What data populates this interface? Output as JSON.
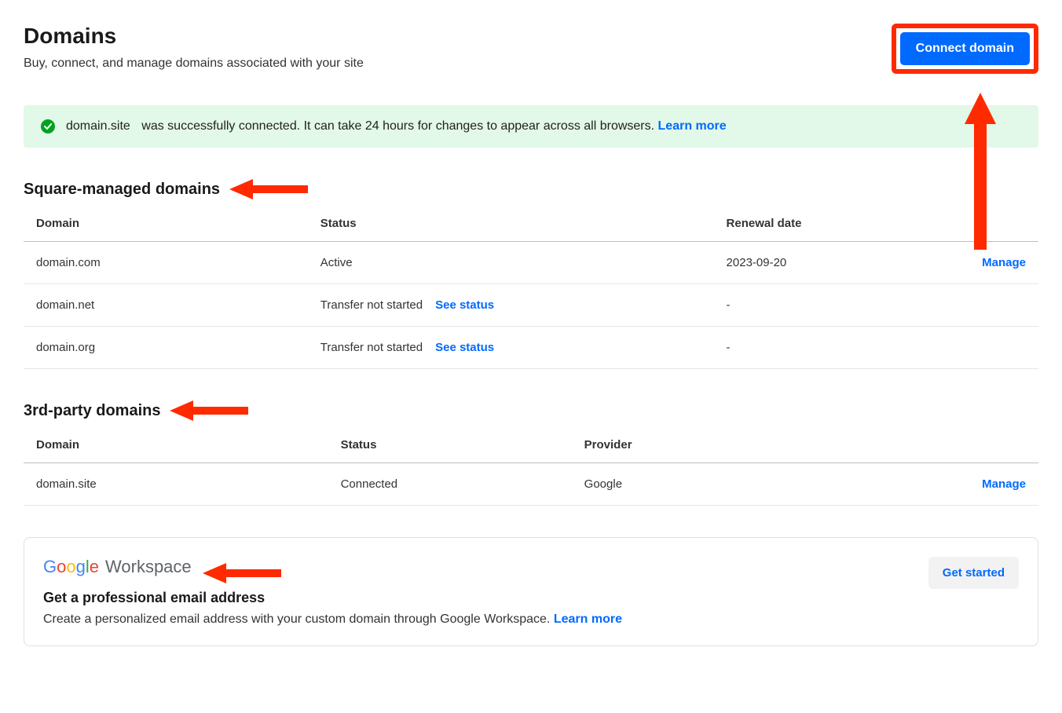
{
  "header": {
    "title": "Domains",
    "subtitle": "Buy, connect, and manage domains associated with your site",
    "connect_button": "Connect domain"
  },
  "banner": {
    "domain": "domain.site",
    "message": "was successfully connected. It can take 24 hours for changes to appear across all browsers.",
    "learn_more": "Learn more"
  },
  "square_section": {
    "title": "Square-managed domains",
    "columns": {
      "domain": "Domain",
      "status": "Status",
      "renewal": "Renewal date"
    },
    "rows": [
      {
        "domain": "domain.com",
        "status": "Active",
        "status_link": "",
        "renewal": "2023-09-20",
        "action": "Manage"
      },
      {
        "domain": "domain.net",
        "status": "Transfer not started",
        "status_link": "See status",
        "renewal": "-",
        "action": ""
      },
      {
        "domain": "domain.org",
        "status": "Transfer not started",
        "status_link": "See status",
        "renewal": "-",
        "action": ""
      }
    ]
  },
  "third_party_section": {
    "title": "3rd-party domains",
    "columns": {
      "domain": "Domain",
      "status": "Status",
      "provider": "Provider"
    },
    "rows": [
      {
        "domain": "domain.site",
        "status": "Connected",
        "provider": "Google",
        "action": "Manage"
      }
    ]
  },
  "workspace_card": {
    "logo_text": "Google Workspace",
    "heading": "Get a professional email address",
    "body": "Create a personalized email address with your custom domain through Google Workspace.",
    "learn_more": "Learn more",
    "button": "Get started"
  },
  "annotations": {
    "arrow_color": "#ff2a00"
  }
}
